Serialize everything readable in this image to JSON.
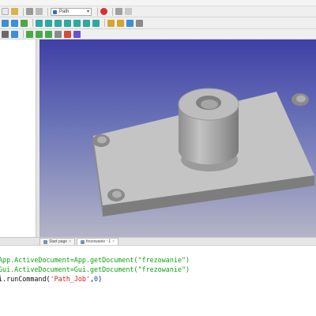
{
  "toolbar": {
    "workbench_label": "Path",
    "icon_colors": [
      "#3a8fd6",
      "#4aa84a",
      "#d64a3a",
      "#8a8a8a",
      "#2fa8a0",
      "#d6a52f",
      "#6a4fd6"
    ]
  },
  "tabs": [
    {
      "label": "Start page",
      "active": false
    },
    {
      "label": "frezowanie : 1",
      "active": true
    }
  ],
  "console": {
    "lines": [
      {
        "segments": [
          {
            "text": "App.ActiveDocument=App.getDocument(\"frezowanie\")",
            "color": "green"
          }
        ]
      },
      {
        "segments": [
          {
            "text": "Gui.ActiveDocument=Gui.getDocument(\"frezowanie\")",
            "color": "green"
          }
        ]
      },
      {
        "segments": [
          {
            "text": "i.runCommand(",
            "color": "default"
          },
          {
            "text": "'Path_Job'",
            "color": "red"
          },
          {
            "text": ",",
            "color": "default"
          },
          {
            "text": "0",
            "color": "blue"
          },
          {
            "text": ")",
            "color": "default"
          }
        ]
      }
    ]
  },
  "colors": {
    "view_top": "#3f3fa6",
    "view_bottom": "#b4b4c6",
    "part_light": "#c4c4c4",
    "part_mid": "#a8a8a8",
    "part_dark": "#7d7d7d"
  }
}
